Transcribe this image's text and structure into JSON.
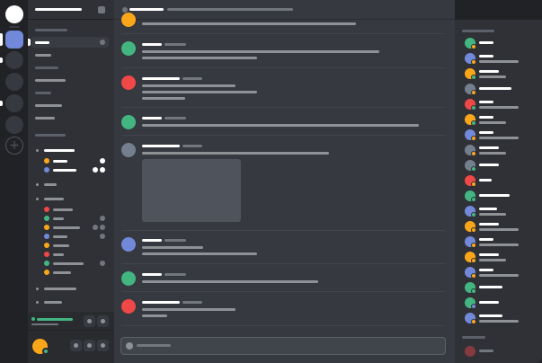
{
  "colors": {
    "blurple": "#7289da",
    "green": "#43b581",
    "red": "#f04747",
    "orange": "#faa61a",
    "gray": "#747f8d",
    "rail_bg": "#202225",
    "sidebar_bg": "#2f3136",
    "chat_bg": "#36393f",
    "panel_bg": "#292b2f",
    "attachment": "#4f535b"
  },
  "icons": {
    "home": "home-icon",
    "add_server": "plus-icon",
    "add_server_glyph": "+",
    "settings": "gear-icon",
    "mute": "microphone-icon",
    "deafen": "headphones-icon",
    "voice_connected": "signal-icon",
    "disconnect": "phone-icon",
    "channel": "hash-icon",
    "upload": "upload-icon"
  },
  "servers": [
    {
      "name": "home",
      "state": "default"
    },
    {
      "name": "server-1",
      "state": "active"
    },
    {
      "name": "server-2",
      "state": "unread"
    },
    {
      "name": "server-3",
      "state": "default"
    },
    {
      "name": "server-4",
      "state": "unread"
    },
    {
      "name": "server-5",
      "state": "default"
    }
  ],
  "guild": {
    "name": ""
  },
  "channel_header": {
    "name": "",
    "topic": ""
  },
  "composer": {
    "placeholder": ""
  },
  "voice_members": [
    {
      "status": "orange"
    },
    {
      "status": "blurple"
    }
  ],
  "voice_channel_members": [
    {
      "color": "#f04747"
    },
    {
      "color": "#43b581"
    },
    {
      "color": "#faa61a"
    },
    {
      "color": "#7289da"
    },
    {
      "color": "#faa61a"
    },
    {
      "color": "#f04747"
    },
    {
      "color": "#43b581"
    },
    {
      "color": "#faa61a"
    }
  ],
  "messages": [
    {
      "avatar": "#faa61a",
      "partial": true
    },
    {
      "avatar": "#43b581"
    },
    {
      "avatar": "#f04747"
    },
    {
      "avatar": "#43b581"
    },
    {
      "avatar": "#747f8d",
      "attachment": true
    },
    {
      "avatar": "#7289da"
    },
    {
      "avatar": "#43b581"
    },
    {
      "avatar": "#f04747"
    }
  ],
  "members_online": [
    {
      "avatar": "#43b581",
      "status": "#faa61a"
    },
    {
      "avatar": "#7289da",
      "status": "#faa61a"
    },
    {
      "avatar": "#faa61a",
      "status": "#43b581"
    },
    {
      "avatar": "#747f8d",
      "status": "#faa61a"
    },
    {
      "avatar": "#f04747",
      "status": "#43b581"
    },
    {
      "avatar": "#faa61a",
      "status": "#43b581"
    },
    {
      "avatar": "#7289da",
      "status": "#faa61a"
    },
    {
      "avatar": "#747f8d",
      "status": "#faa61a"
    },
    {
      "avatar": "#747f8d",
      "status": "#43b581"
    },
    {
      "avatar": "#f04747",
      "status": "#faa61a"
    },
    {
      "avatar": "#43b581",
      "status": "#43b581"
    },
    {
      "avatar": "#7289da",
      "status": "#43b581"
    },
    {
      "avatar": "#faa61a",
      "status": "#faa61a"
    },
    {
      "avatar": "#7289da",
      "status": "#faa61a"
    },
    {
      "avatar": "#faa61a",
      "status": "#faa61a"
    },
    {
      "avatar": "#7289da",
      "status": "#faa61a"
    },
    {
      "avatar": "#43b581",
      "status": "#43b581"
    },
    {
      "avatar": "#43b581",
      "status": "#7289da"
    },
    {
      "avatar": "#7289da",
      "status": "#faa61a"
    }
  ],
  "members_offline": [
    {
      "avatar": "#f04747"
    }
  ],
  "user": {
    "avatar": "#faa61a",
    "status": "#43b581"
  }
}
